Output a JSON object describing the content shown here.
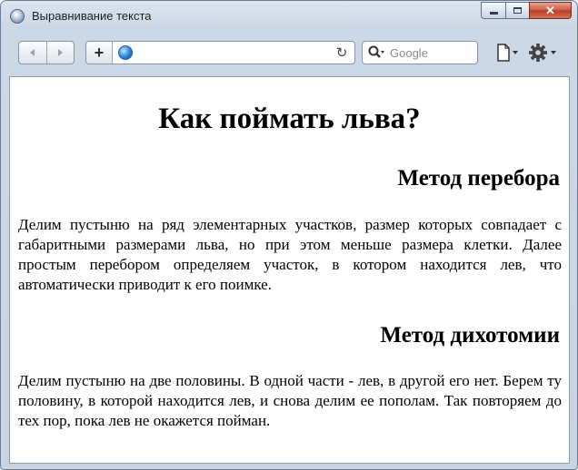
{
  "window": {
    "title": "Выравнивание текста",
    "caption_buttons": {
      "close_symbol": "✕"
    }
  },
  "toolbar": {
    "back_icon": "back-arrow-icon",
    "forward_icon": "forward-arrow-icon",
    "add_tab_symbol": "+",
    "address_value": "",
    "reload_symbol": "↻",
    "search_placeholder": "Google"
  },
  "page": {
    "title": "Как поймать льва?",
    "sections": [
      {
        "heading": "Метод перебора",
        "text": "Делим пустыню на ряд элементарных участков, размер которых совпадает с габаритными размерами льва, но при этом меньше размера клетки. Далее простым перебором определяем участок, в котором находится лев, что автоматически приводит к его поимке."
      },
      {
        "heading": "Метод дихотомии",
        "text": "Делим пустыню на две половины. В одной части - лев, в другой его нет. Берем ту половину, в которой находится лев, и снова делим ее пополам. Так повторяем до тех пор, пока лев не окажется пойман."
      }
    ]
  },
  "colors": {
    "frame": "#c9d4e2",
    "close_button": "#c7573f",
    "content_background": "#ffffff"
  }
}
